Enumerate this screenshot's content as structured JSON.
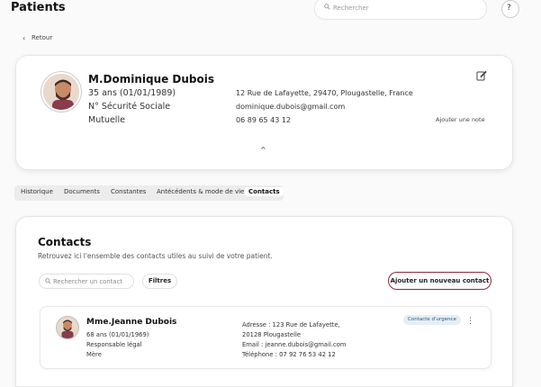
{
  "header": {
    "title": "Patients",
    "search_placeholder": "Rechercher",
    "help_label": "?"
  },
  "back_label": "Retour",
  "patient": {
    "name": "M.Dominique Dubois",
    "age": "35 ans (01/01/1989)",
    "ssn_label": "N° Sécurité Sociale",
    "mutuelle_label": "Mutuelle",
    "address": "12 Rue de Lafayette, 29470, Plougastelle, France",
    "email": "dominique.dubois@gmail.com",
    "phone": "06 89 65 43 12",
    "add_note": "Ajouter une note"
  },
  "tabs": [
    {
      "label": "Historique",
      "active": false
    },
    {
      "label": "Documents",
      "active": false
    },
    {
      "label": "Constantes",
      "active": false
    },
    {
      "label": "Antécédents & mode de vie",
      "active": false
    },
    {
      "label": "Contacts",
      "active": true
    }
  ],
  "contacts": {
    "title": "Contacts",
    "subtitle": "Retrouvez ici l'ensemble des contacts utiles au suivi de votre patient.",
    "search_placeholder": "Rechercher un contact",
    "filters_label": "Filtres",
    "add_label": "Ajouter un nouveau contact",
    "items": [
      {
        "name": "Mme.Jeanne Dubois",
        "age": "68 ans (01/01/1969)",
        "role": "Responsable légal",
        "relation": "Mère",
        "address_line1": "Adresse :  123 Rue de Lafayette,",
        "address_line2": "20128 Plougastelle",
        "email": "Email : jeanne.dubois@gmail.com",
        "phone": "Téléphone : 07 92 76 53 42 12",
        "badge": "Contacte d'urgence"
      }
    ]
  },
  "colors": {
    "accent": "#8a2b3c",
    "badge_bg": "#e6eef5",
    "badge_text": "#2a5a80"
  },
  "icons": [
    "search-icon",
    "help-icon",
    "chevron-left-icon",
    "edit-icon",
    "chevron-up-icon",
    "more-vertical-icon"
  ]
}
